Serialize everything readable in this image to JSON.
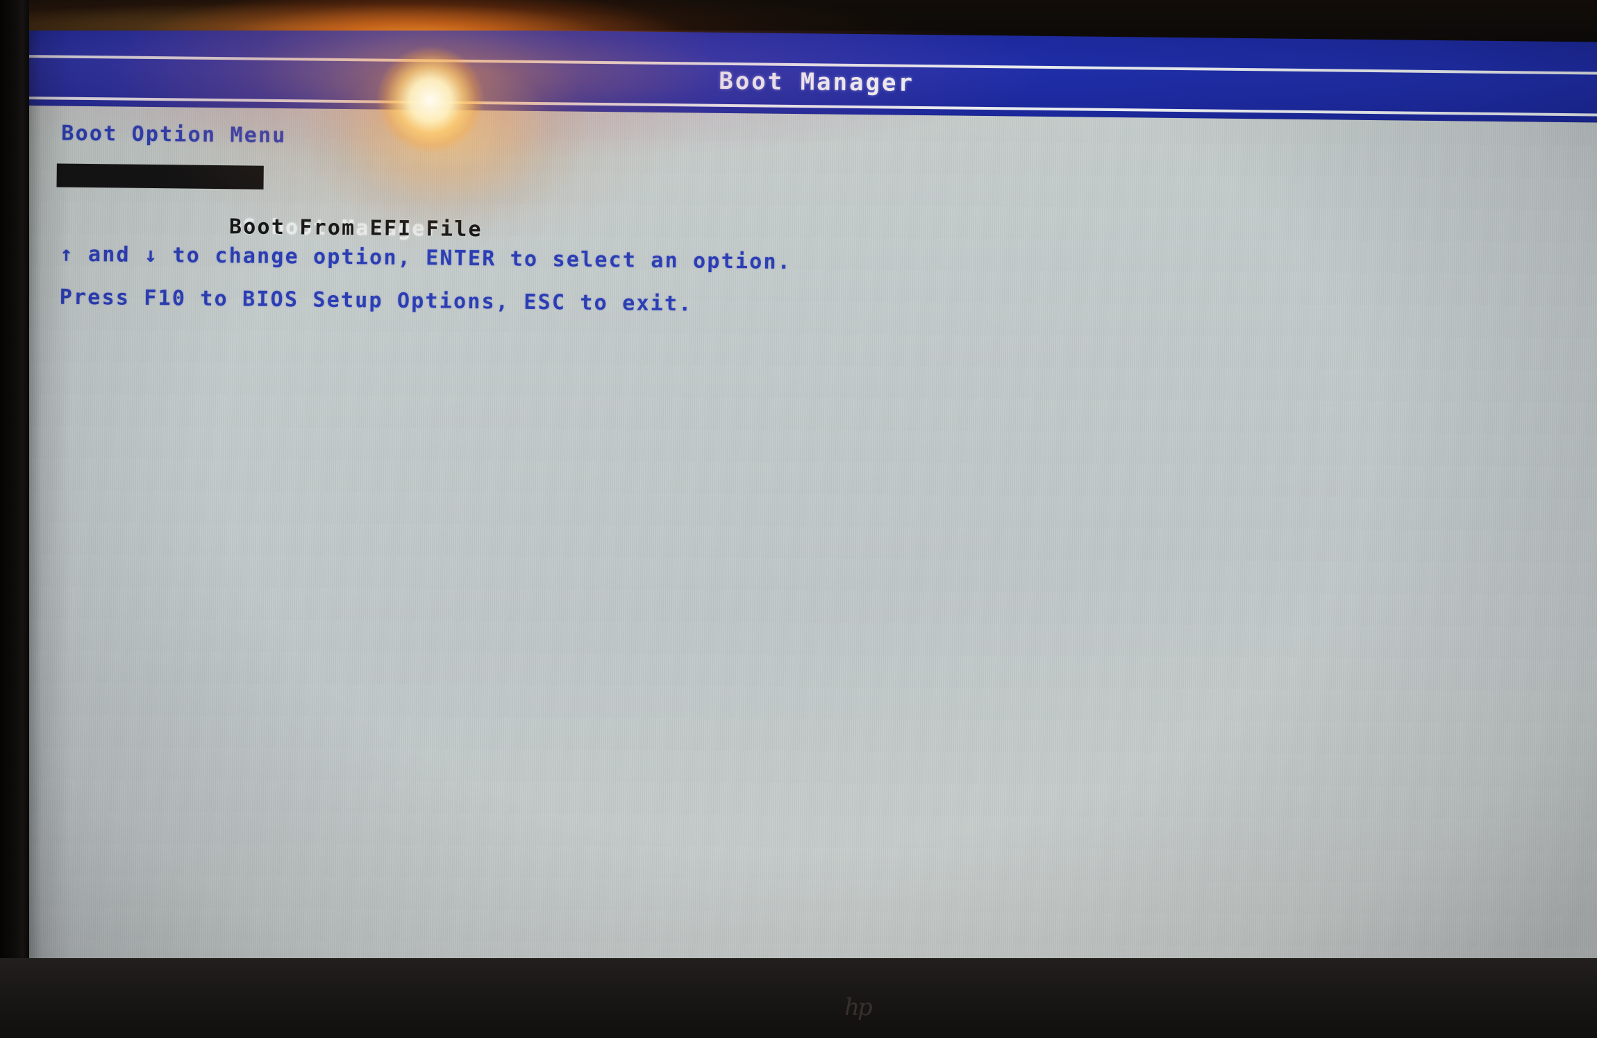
{
  "screen": {
    "header": {
      "title": "Boot Manager",
      "bar_color": "#1f2ea8",
      "title_color": "#f2f4f6",
      "rule_color": "#e9ecef"
    },
    "body": {
      "background_color": "#c4cbc9",
      "text_color": "#2c3eb4",
      "heading": "Boot Option Menu",
      "boot_options": [
        {
          "label": "OS boot Manager",
          "selected": true
        },
        {
          "label": "Boot From EFI File",
          "selected": false
        }
      ],
      "selected_highlight_background": "#141414",
      "selected_highlight_text_color": "#e8ecec",
      "option_text_color": "#171717",
      "hints": [
        "↑ and ↓ to change option, ENTER to select an option.",
        "Press F10 to BIOS Setup Options, ESC to exit."
      ]
    }
  },
  "device": {
    "brand_logo": "hp",
    "bezel_color": "#0d0b0a",
    "bottom_bezel_color": "#1b1917"
  },
  "photo_artifacts": {
    "glare_label": "camera-flash-glare",
    "glare_color": "#ffd27a",
    "top_bezel_glow_color": "#e1691a"
  }
}
